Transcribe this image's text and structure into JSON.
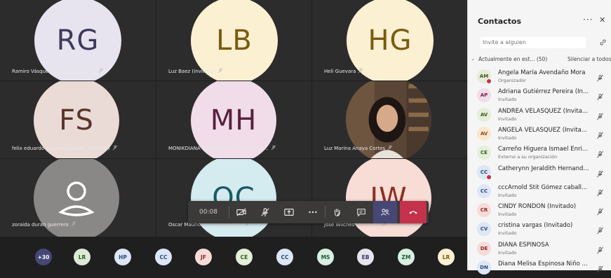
{
  "tiles": [
    {
      "initials": "RG",
      "name": "Ramiro Vásquez Giraldo (Invitado)",
      "bg": "#e8e4ef",
      "fg": "#3d3a5c"
    },
    {
      "initials": "LB",
      "name": "Luz Baez (Invitado)",
      "bg": "#fbf0d2",
      "fg": "#7a5a10"
    },
    {
      "initials": "HG",
      "name": "Heli Guevara",
      "bg": "#fbf0d2",
      "fg": "#7a5a10"
    },
    {
      "initials": "FS",
      "name": "felix eduardo guzman salazar (Invitado)",
      "bg": "#eadbd7",
      "fg": "#5a342a"
    },
    {
      "initials": "MH",
      "name": "MONIKDIANA HERNÁNDEZ - ALIRIO MO...",
      "bg": "#f0dde9",
      "fg": "#5a2040"
    },
    {
      "initials": "",
      "name": "Luz Marina Anaya Cortes",
      "bg": "#4a3a30",
      "fg": "#ffffff"
    },
    {
      "initials": "",
      "name": "zoraida duran guerrero",
      "bg": "#8a8886",
      "fg": "#ffffff"
    },
    {
      "initials": "OC",
      "name": "Oscar Mauricio Cely (Invitado)",
      "bg": "#d4ebf0",
      "fg": "#1a5a66"
    },
    {
      "initials": "JW",
      "name": "Jose Wilches (Invitado)",
      "bg": "#f8dcd6",
      "fg": "#8a3020"
    }
  ],
  "controls": {
    "timer": "00:08"
  },
  "bottom_avatars": [
    {
      "label": "+30",
      "bg": "#464775",
      "fg": "#ffffff"
    },
    {
      "label": "LR",
      "bg": "#dcead7",
      "fg": "#2d5a22"
    },
    {
      "label": "HP",
      "bg": "#dde6f5",
      "fg": "#2a4a7a"
    },
    {
      "label": "CC",
      "bg": "#dde6f5",
      "fg": "#2a4a7a"
    },
    {
      "label": "JF",
      "bg": "#f6dbd8",
      "fg": "#8a2a20"
    },
    {
      "label": "CE",
      "bg": "#e3efd8",
      "fg": "#3a5a20"
    },
    {
      "label": "CC",
      "bg": "#dde6f5",
      "fg": "#2a4a7a"
    },
    {
      "label": "MS",
      "bg": "#d8efe2",
      "fg": "#1f5a3a"
    },
    {
      "label": "EB",
      "bg": "#e8e4ef",
      "fg": "#3d3a5c"
    },
    {
      "label": "ZM",
      "bg": "#d8efe2",
      "fg": "#1f5a3a"
    },
    {
      "label": "LR",
      "bg": "#fbf0d2",
      "fg": "#7a5a10"
    }
  ],
  "panel": {
    "title": "Contactos",
    "more": "···",
    "close": "✕",
    "invite_placeholder": "Invite a alguien",
    "section_label": "Actualmente en est... (50)",
    "mute_all": "Silenciar a todos",
    "people": [
      {
        "initials": "AM",
        "name": "Angela María Avendaño Mora",
        "role": "Organizador",
        "bg": "#e6ecd8",
        "fg": "#3a5a20",
        "presence": true
      },
      {
        "initials": "AP",
        "name": "Adriana Gutiérrez Pereira (In...",
        "role": "Invitado",
        "bg": "#f0dde9",
        "fg": "#7a2050",
        "presence": false
      },
      {
        "initials": "AV",
        "name": "ANDREA VELÁSQUEZ (Invita...",
        "role": "Invitado",
        "bg": "#e3efd8",
        "fg": "#3a5a20",
        "presence": false
      },
      {
        "initials": "AV",
        "name": "ANGELA VELASQUEZ (Invita...",
        "role": "Invitado",
        "bg": "#fbe6cf",
        "fg": "#8a4a10",
        "presence": false
      },
      {
        "initials": "CE",
        "name": "Carreño Higuera Ismael Enri...",
        "role": "Externo a su organización",
        "bg": "#e3efd8",
        "fg": "#3a5a20",
        "presence": false
      },
      {
        "initials": "CC",
        "name": "Catherynn Jeraldith Hernand...",
        "role": "",
        "bg": "#dde6f5",
        "fg": "#2a4a7a",
        "presence": true
      },
      {
        "initials": "CC",
        "name": "cccArnold Stit Gómez caball...",
        "role": "Invitado",
        "bg": "#dde6f5",
        "fg": "#2a4a7a",
        "presence": false
      },
      {
        "initials": "CR",
        "name": "CINDY RONDON (Invitado)",
        "role": "Invitado",
        "bg": "#f6dbd8",
        "fg": "#8a2a20",
        "presence": false
      },
      {
        "initials": "CV",
        "name": "cristina vargas (Invitado)",
        "role": "Invitado",
        "bg": "#dde6f5",
        "fg": "#2a4a7a",
        "presence": false
      },
      {
        "initials": "DE",
        "name": "DIANA ESPINOSA",
        "role": "Invitado",
        "bg": "#f6dbd8",
        "fg": "#8a2a20",
        "presence": false
      },
      {
        "initials": "DN",
        "name": "Diana Melisa Espinosa Niño ...",
        "role": "",
        "bg": "#dde6f5",
        "fg": "#2a4a7a",
        "presence": false
      }
    ]
  }
}
